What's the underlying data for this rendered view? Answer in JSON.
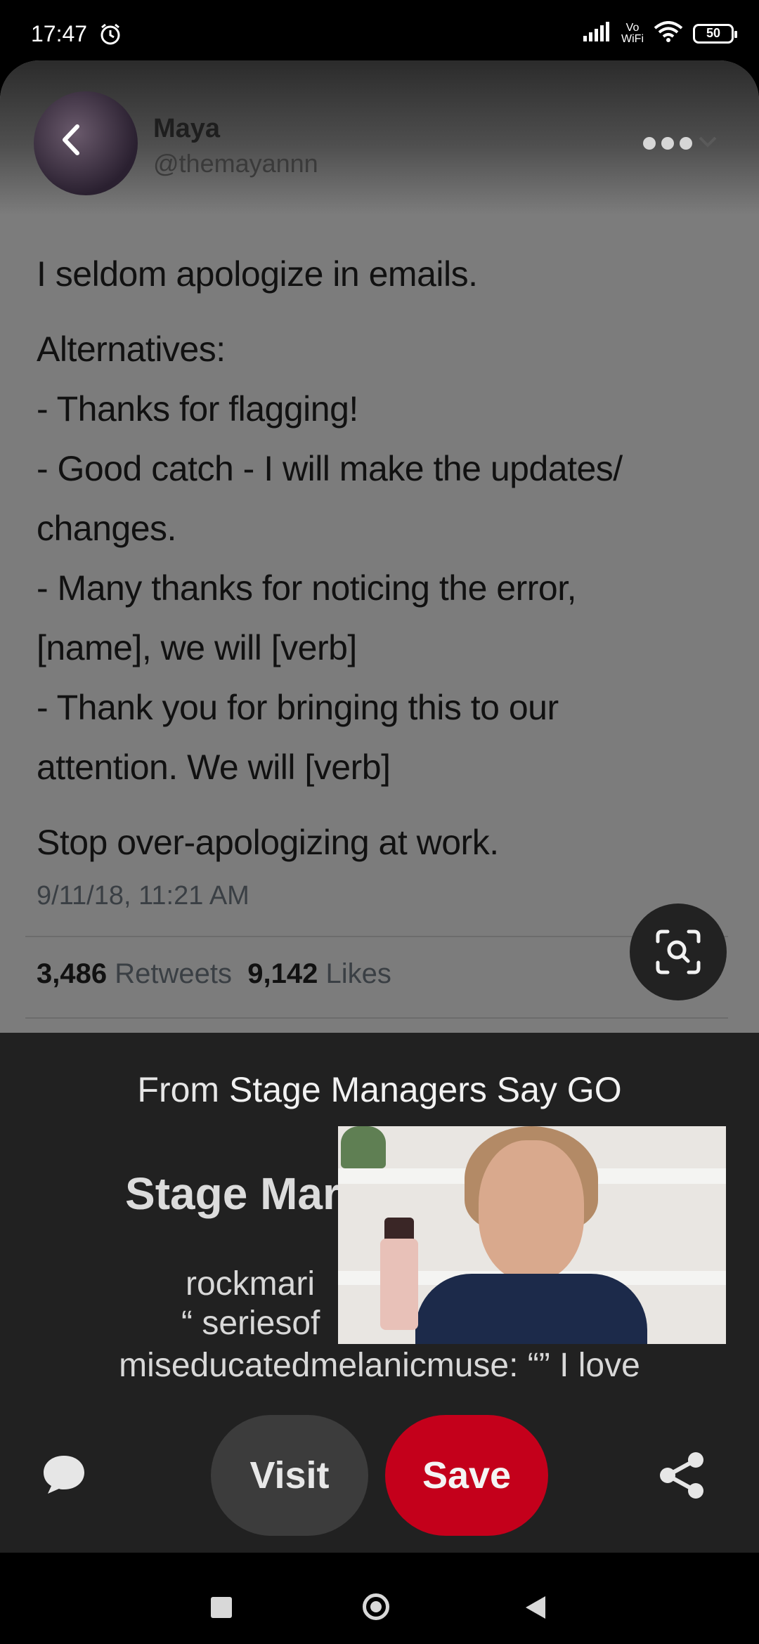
{
  "status_bar": {
    "time": "17:47",
    "network_label": "Vo\nWiFi",
    "battery": "50",
    "alarm_icon": "alarm-icon",
    "signal_icon": "signal-icon",
    "wifi_icon": "wifi-icon"
  },
  "tweet": {
    "user_name": "Maya",
    "user_handle": "@themayannn",
    "lines": [
      "I seldom apologize in emails.",
      "Alternatives:",
      "- Thanks for flagging!",
      "- Good catch - I will make the updates/",
      "changes.",
      "- Many thanks for noticing the error,",
      "[name], we will [verb]",
      "- Thank you for bringing this to our",
      "attention. We will [verb]",
      "Stop over-apologizing at work."
    ],
    "timestamp": "9/11/18, 11:21 AM",
    "retweets_count": "3,486",
    "retweets_label": "Retweets",
    "likes_count": "9,142",
    "likes_label": "Likes"
  },
  "sheet": {
    "from_prefix": "From",
    "board_name": "Stage Managers Say GO",
    "title_visible": "Stage Mar",
    "desc_line1": "rockmari",
    "desc_line2": "“ seriesof",
    "desc_line3": "miseducatedmelanicmuse: “” I love",
    "visit_label": "Visit",
    "save_label": "Save"
  },
  "colors": {
    "save": "#c4001b",
    "sheet_bg": "#212121"
  }
}
